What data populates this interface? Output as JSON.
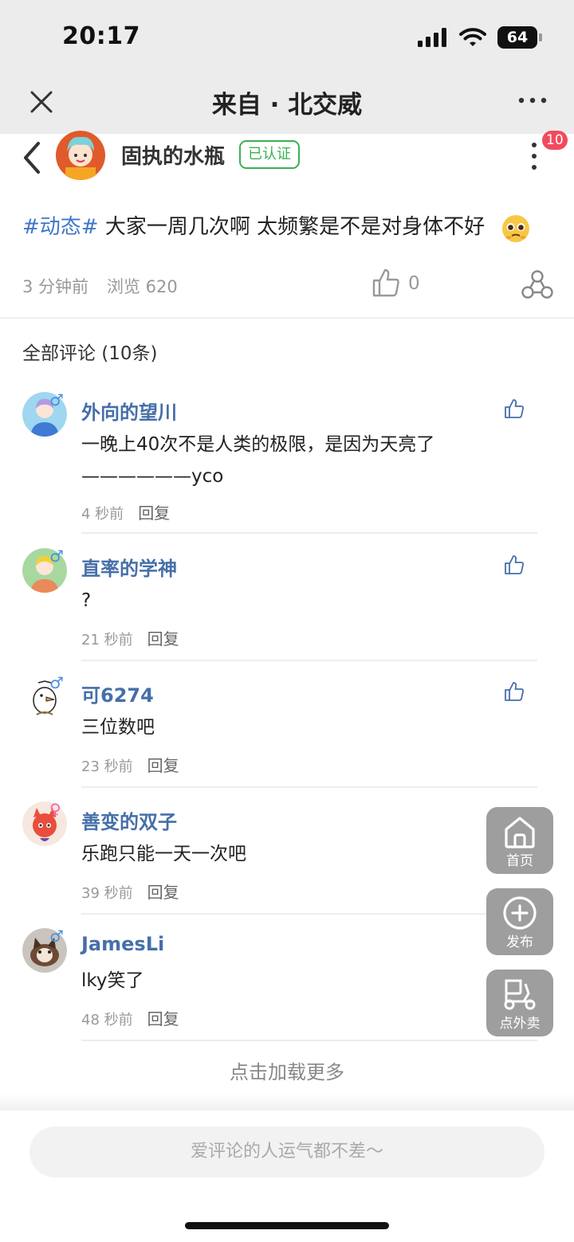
{
  "status_bar": {
    "time": "20:17",
    "battery": "64"
  },
  "nav": {
    "title": "来自 · 北交威"
  },
  "author": {
    "name": "固执的水瓶",
    "verified_label": "已认证",
    "notification_count": "10"
  },
  "post": {
    "topic": "#动态#",
    "text": " 大家一周几次啊 太频繁是不是对身体不好",
    "time": "3 分钟前",
    "views": "浏览 620",
    "likes": "0"
  },
  "comments_header": "全部评论 (10条)",
  "comments": [
    {
      "name": "外向的望川",
      "gender": "♂",
      "text": "一晚上40次不是人类的极限，是因为天亮了——————yco",
      "time": "4 秒前",
      "reply": "回复"
    },
    {
      "name": "直率的学神",
      "gender": "♂",
      "text": "?",
      "time": "21 秒前",
      "reply": "回复"
    },
    {
      "name": "可6274",
      "gender": "♂",
      "text": "三位数吧",
      "time": "23 秒前",
      "reply": "回复"
    },
    {
      "name": "善变的双子",
      "gender": "♀",
      "text": "乐跑只能一天一次吧",
      "time": "39 秒前",
      "reply": "回复"
    },
    {
      "name": "JamesLi",
      "gender": "♂",
      "text": "lky笑了",
      "time": "48 秒前",
      "reply": "回复"
    }
  ],
  "load_more": "点击加载更多",
  "fabs": {
    "home": "首页",
    "publish": "发布",
    "takeout": "点外卖"
  },
  "input": {
    "placeholder": "爱评论的人运气都不差～"
  },
  "colors": {
    "link_blue": "#466fa9",
    "topic_blue": "#3e77c8",
    "verified_green": "#3ab054",
    "badge_red": "#f14a5e"
  }
}
